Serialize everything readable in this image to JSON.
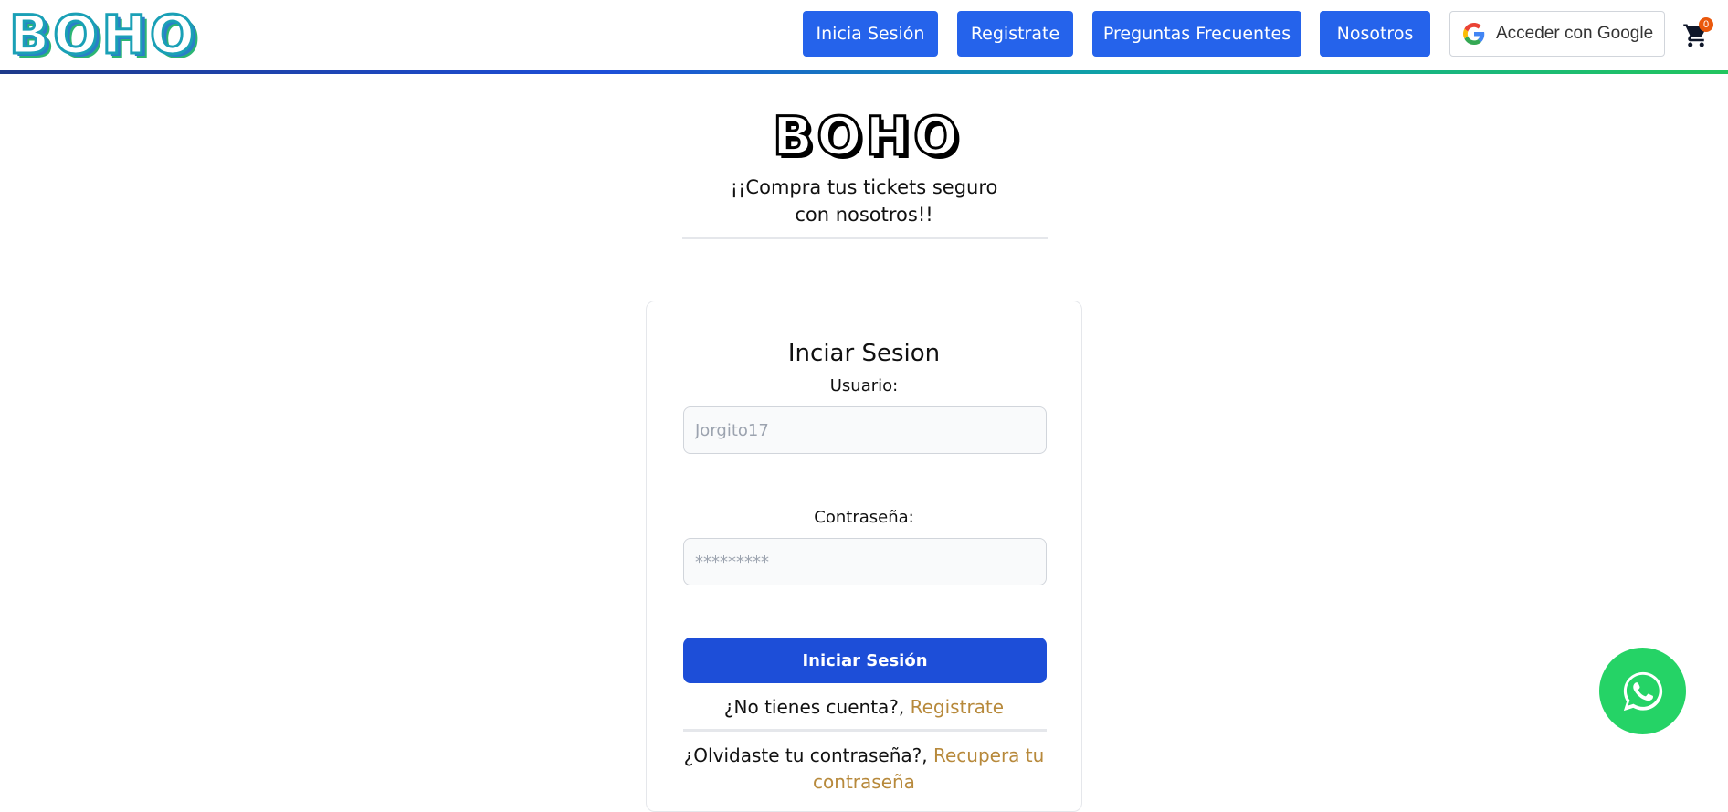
{
  "brand": {
    "logo_text": "BOHO"
  },
  "nav": {
    "items": [
      {
        "label": "Inicia Sesión"
      },
      {
        "label": "Registrate"
      },
      {
        "label": "Preguntas Frecuentes"
      },
      {
        "label": "Nosotros"
      }
    ],
    "google_label": "Acceder con Google",
    "cart_count": "0"
  },
  "hero": {
    "logo_text": "BOHO",
    "tagline": "¡¡Compra tus tickets seguro con nosotros!!"
  },
  "login": {
    "title": "Inciar Sesion",
    "user_label": "Usuario:",
    "user_placeholder": "Jorgito17",
    "password_label": "Contraseña:",
    "password_placeholder": "*********",
    "submit_label": "Iniciar Sesión",
    "no_account_text": "¿No tienes cuenta?, ",
    "register_link": "Registrate",
    "forgot_text": "¿Olvidaste tu contraseña?, ",
    "recover_link": "Recupera tu contraseña"
  },
  "colors": {
    "primary": "#2563eb",
    "submit": "#1d4ed8",
    "link": "#b7893b",
    "whatsapp": "#25d366",
    "badge": "#ea580c"
  },
  "icons": {
    "google": "google-icon",
    "cart": "shopping-cart-icon",
    "whatsapp": "whatsapp-icon"
  }
}
